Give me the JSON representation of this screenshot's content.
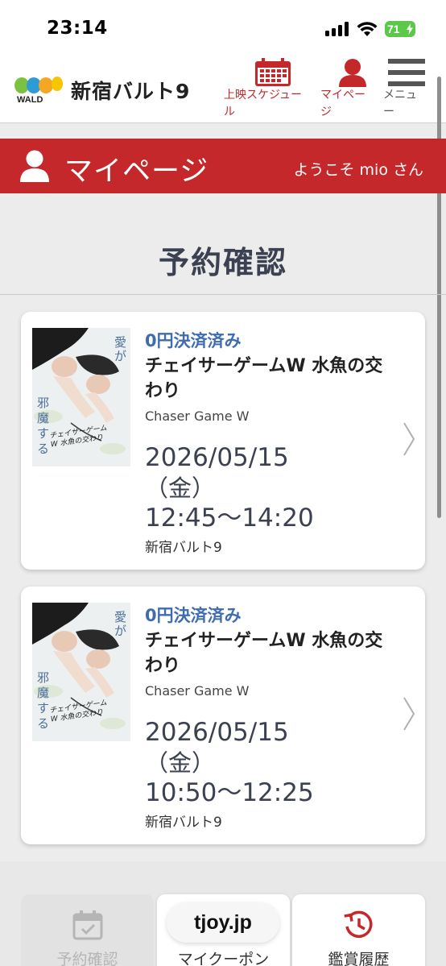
{
  "status_bar": {
    "time": "23:14",
    "battery": "71"
  },
  "header": {
    "logo_sub": "WALD",
    "title": "新宿バルト9",
    "schedule_label": "上映スケジュール",
    "mypage_label": "マイページ",
    "menu_label": "メニュー"
  },
  "banner": {
    "title": "マイページ",
    "welcome": "ようこそ mio さん"
  },
  "page": {
    "title": "予約確認"
  },
  "poster_text": {
    "tagline": [
      "愛が",
      "邪魔する"
    ],
    "movie_logo": "チェイサーゲームW 水魚の交わり"
  },
  "reservations": [
    {
      "status": "0円決済済み",
      "title": "チェイサーゲームW 水魚の交わり",
      "title_en": "Chaser Game W",
      "date": "2026/05/15",
      "weekday": "（金）",
      "time": "12:45～14:20",
      "theater": "新宿バルト9"
    },
    {
      "status": "0円決済済み",
      "title": "チェイサーゲームW 水魚の交わり",
      "title_en": "Chaser Game W",
      "date": "2026/05/15",
      "weekday": "（金）",
      "time": "10:50～12:25",
      "theater": "新宿バルト9"
    }
  ],
  "bottom_tabs": [
    {
      "label": "予約確認",
      "icon": "calendar-check-icon"
    },
    {
      "label": "マイクーポン",
      "icon": "coupon-icon"
    },
    {
      "label": "鑑賞履歴",
      "icon": "history-clock-icon"
    }
  ],
  "browser": {
    "url": "tjoy.jp"
  },
  "colors": {
    "brand_red": "#c5282a",
    "status_blue": "#3f6cb0",
    "text_dark": "#3b4150"
  }
}
